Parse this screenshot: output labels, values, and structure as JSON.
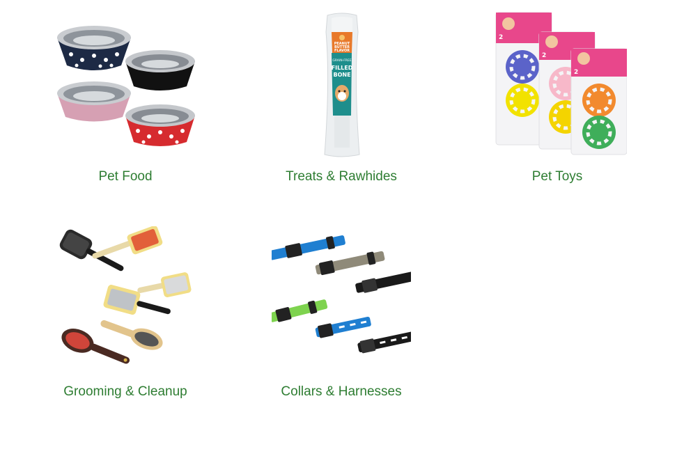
{
  "categories": [
    {
      "label": "Pet Food",
      "image": "pet-bowls-image"
    },
    {
      "label": "Treats & Rawhides",
      "image": "filled-bone-treat-image"
    },
    {
      "label": "Pet Toys",
      "image": "cat-ball-toys-image"
    },
    {
      "label": "Grooming & Cleanup",
      "image": "pet-brushes-image"
    },
    {
      "label": "Collars & Harnesses",
      "image": "dog-collars-image"
    }
  ],
  "product_text": {
    "treat_top": "PEANUT BUTTER FLAVOR",
    "treat_flavor_1": "PEANUT",
    "treat_flavor_2": "BUTTER",
    "treat_flavor_3": "FLAVOR",
    "treat_grain": "GRAIN-FREE",
    "treat_name_1": "FILLED",
    "treat_name_2": "BONE",
    "toy_count": "2"
  },
  "colors": {
    "label_green": "#2e7d32"
  }
}
